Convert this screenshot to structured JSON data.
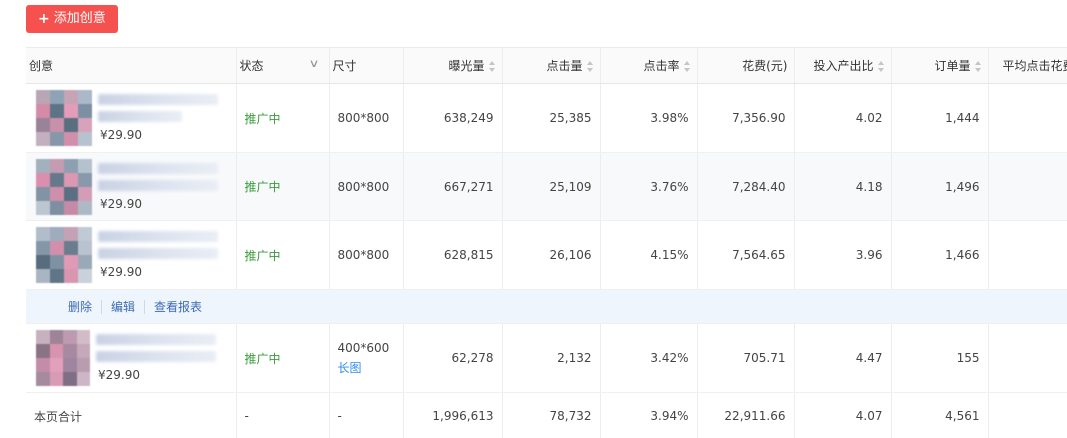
{
  "toolbar": {
    "add_label": "添加创意"
  },
  "columns": {
    "creative": "创意",
    "status": "状态",
    "size": "尺寸",
    "impressions": "曝光量",
    "clicks": "点击量",
    "ctr": "点击率",
    "cost": "花费(元)",
    "roi": "投入产出比",
    "orders": "订单量",
    "avg_cpc": "平均点击花费"
  },
  "rows": [
    {
      "price": "¥29.90",
      "status": "推广中",
      "size": "800*800",
      "size_tag": "",
      "impressions": "638,249",
      "clicks": "25,385",
      "ctr": "3.98%",
      "cost": "7,356.90",
      "roi": "4.02",
      "orders": "1,444"
    },
    {
      "price": "¥29.90",
      "status": "推广中",
      "size": "800*800",
      "size_tag": "",
      "impressions": "667,271",
      "clicks": "25,109",
      "ctr": "3.76%",
      "cost": "7,284.40",
      "roi": "4.18",
      "orders": "1,496"
    },
    {
      "price": "¥29.90",
      "status": "推广中",
      "size": "800*800",
      "size_tag": "",
      "impressions": "628,815",
      "clicks": "26,106",
      "ctr": "4.15%",
      "cost": "7,564.65",
      "roi": "3.96",
      "orders": "1,466"
    },
    {
      "price": "¥29.90",
      "status": "推广中",
      "size": "400*600",
      "size_tag": "长图",
      "impressions": "62,278",
      "clicks": "2,132",
      "ctr": "3.42%",
      "cost": "705.71",
      "roi": "4.47",
      "orders": "155"
    }
  ],
  "row_actions": {
    "delete": "删除",
    "edit": "编辑",
    "report": "查看报表"
  },
  "totals": {
    "label": "本页合计",
    "status": "-",
    "size": "-",
    "impressions": "1,996,613",
    "clicks": "78,732",
    "ctr": "3.94%",
    "cost": "22,911.66",
    "roi": "4.07",
    "orders": "4,561"
  },
  "colors": {
    "accent": "#f5524f",
    "status_active": "#3b9b3b",
    "link": "#3d6bb3",
    "tag": "#2d8cf0",
    "action_row_bg": "#eef5fd"
  }
}
